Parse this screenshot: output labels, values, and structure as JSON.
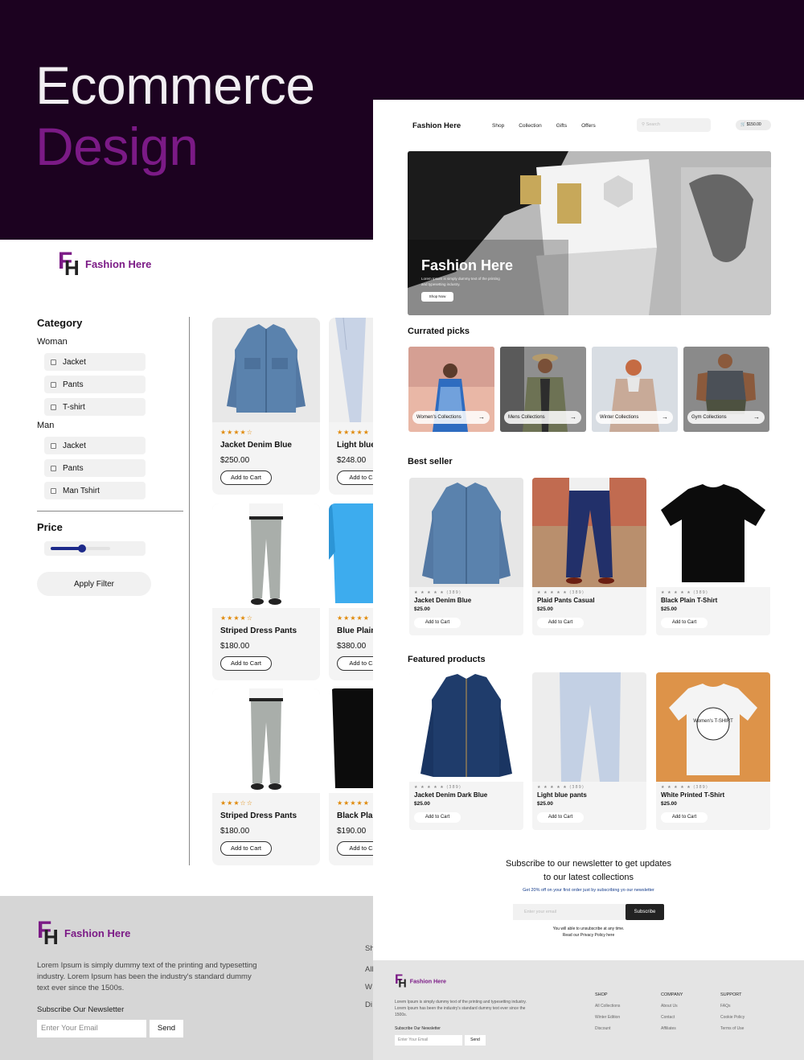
{
  "hero": {
    "line1": "Ecommerce",
    "line2": "Design"
  },
  "brand": {
    "name": "Fashion Here",
    "mark_f": "F",
    "mark_h": "H"
  },
  "filters": {
    "category_title": "Category",
    "groups": [
      {
        "name": "Woman",
        "items": [
          "Jacket",
          "Pants",
          "T-shirt"
        ]
      },
      {
        "name": "Man",
        "items": [
          "Jacket",
          "Pants",
          "Man Tshirt"
        ]
      }
    ],
    "price_title": "Price",
    "price_level": 0.5,
    "apply_label": "Apply Filter"
  },
  "catalog": [
    {
      "name": "Jacket Denim Blue",
      "price": "$250.00",
      "rating": 4,
      "button": "Add to Cart"
    },
    {
      "name": "Light blue",
      "price": "$248.00",
      "rating": 5,
      "button": "Add to Ca"
    },
    {
      "name": "Striped Dress Pants",
      "price": "$180.00",
      "rating": 4,
      "button": "Add to Cart"
    },
    {
      "name": "Blue Plain",
      "price": "$380.00",
      "rating": 5,
      "button": "Add to Ca"
    },
    {
      "name": "Striped Dress Pants",
      "price": "$180.00",
      "rating": 3,
      "button": "Add to Cart"
    },
    {
      "name": "Black Plai",
      "price": "$190.00",
      "rating": 5,
      "button": "Add to Ca"
    }
  ],
  "left_footer": {
    "description": "Lorem Ipsum is simply dummy text of the printing and typesetting industry. Lorem Ipsum has been the industry's standard dummy text ever since the 1500s.",
    "subscribe_label": "Subscribe Our Newsletter",
    "email_placeholder": "Enter Your Email",
    "send_label": "Send",
    "cut_items": [
      "Sh",
      "All",
      "W",
      "Di"
    ]
  },
  "nav": {
    "links": [
      "Shop",
      "Collection",
      "Gifts",
      "Offers"
    ],
    "search_placeholder": "Search",
    "cart_total": "$150.00"
  },
  "banner": {
    "title": "Fashion Here",
    "description": "Lorem Ipsum is simply dummy text of the printing and typesetting industry.",
    "cta": "Shop Now"
  },
  "curated": {
    "title": "Currated picks",
    "items": [
      "Women's Collections",
      "Mens Collections",
      "Winter Collections",
      "Gym Collections"
    ]
  },
  "best_seller": {
    "title": "Best seller",
    "items": [
      {
        "name": "Jacket Denim Blue",
        "price": "$25.00",
        "reviews": "(389)",
        "button": "Add to Cart"
      },
      {
        "name": "Plaid Pants Casual",
        "price": "$25.00",
        "reviews": "(389)",
        "button": "Add to Cart"
      },
      {
        "name": "Black Plain T-Shirt",
        "price": "$25.00",
        "reviews": "(389)",
        "button": "Add to Cart"
      }
    ]
  },
  "featured": {
    "title": "Featured products",
    "items": [
      {
        "name": "Jacket Denim Dark Blue",
        "price": "$25.00",
        "reviews": "(389)",
        "button": "Add to Cart"
      },
      {
        "name": "Light blue pants",
        "price": "$25.00",
        "reviews": "(389)",
        "button": "Add to Cart"
      },
      {
        "name": "White Printed T-Shirt",
        "price": "$25.00",
        "reviews": "(389)",
        "button": "Add to Cart",
        "print_text": "Women's T-SHIRT"
      }
    ]
  },
  "newsletter": {
    "title_line1": "Subscribe to our newsletter to get updates",
    "title_line2": "to our latest collections",
    "subtitle": "Get 20% off on your first order just by subscribing yo our newsletter",
    "placeholder": "Enter your email",
    "button": "Subscribe",
    "note_line1": "You will able to unsubscribe at any time.",
    "note_line2": "Read our Privacy Policy here"
  },
  "right_footer": {
    "description": "Lorem Ipsum is simply dummy text of the printing and typesetting industry. Lorem Ipsum has been the industry's standard dummy text ever since the 1500s.",
    "subscribe_label": "Subscribe Our Newsletter",
    "email_placeholder": "Enter Your Email",
    "send_label": "Send",
    "columns": [
      {
        "title": "SHOP",
        "links": [
          "All Collections",
          "Winter Edition",
          "Discount"
        ]
      },
      {
        "title": "COMPANY",
        "links": [
          "About Us",
          "Contact",
          "Affiliates"
        ]
      },
      {
        "title": "SUPPORT",
        "links": [
          "FAQs",
          "Cookie Policy",
          "Terms of Use"
        ]
      }
    ]
  }
}
